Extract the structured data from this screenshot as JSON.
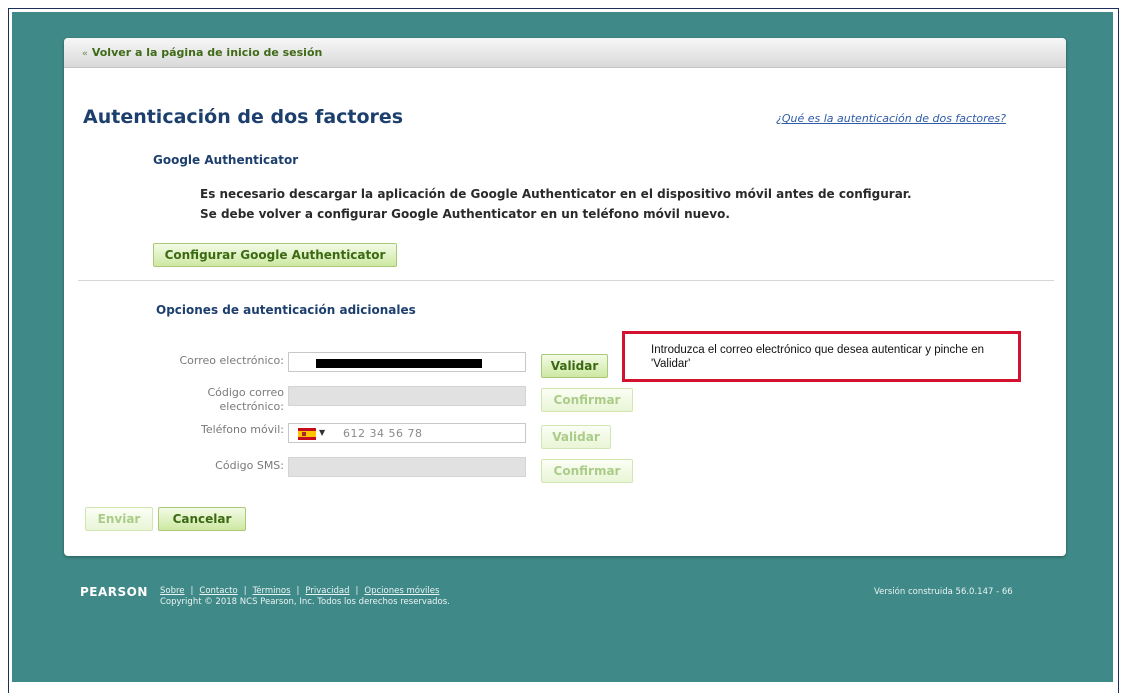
{
  "back_link": "Volver a la página de inicio de sesión",
  "page_title": "Autenticación de dos factores",
  "help_link": "¿Qué es la autenticación de dos factores?",
  "google": {
    "heading": "Google Authenticator",
    "line1": "Es necesario descargar la aplicación de Google Authenticator en el dispositivo móvil antes de configurar.",
    "line2": "Se debe volver a configurar Google Authenticator en un teléfono móvil nuevo.",
    "button": "Configurar Google Authenticator"
  },
  "additional": {
    "heading": "Opciones de autenticación adicionales",
    "email_label": "Correo electrónico:",
    "email_code_label_1": "Código correo",
    "email_code_label_2": "electrónico:",
    "phone_label": "Teléfono móvil:",
    "phone_placeholder": "612 34 56 78",
    "sms_label": "Código SMS:",
    "validate": "Validar",
    "confirm": "Confirmar"
  },
  "callout": "Introduzca el correo electrónico que desea autenticar y pinche en 'Validar'",
  "actions": {
    "send": "Enviar",
    "cancel": "Cancelar"
  },
  "footer": {
    "logo": "PEARSON",
    "links": [
      "Sobre",
      "Contacto",
      "Términos",
      "Privacidad",
      "Opciones móviles"
    ],
    "copyright": "Copyright © 2018 NCS Pearson, Inc. Todos los derechos reservados.",
    "version": "Versión construida 56.0.147 - 66"
  },
  "colors": {
    "teal_background": "#3f8a88",
    "title_blue": "#1d3f6e",
    "button_green": "#cde8a2",
    "callout_red": "#d2122e"
  }
}
